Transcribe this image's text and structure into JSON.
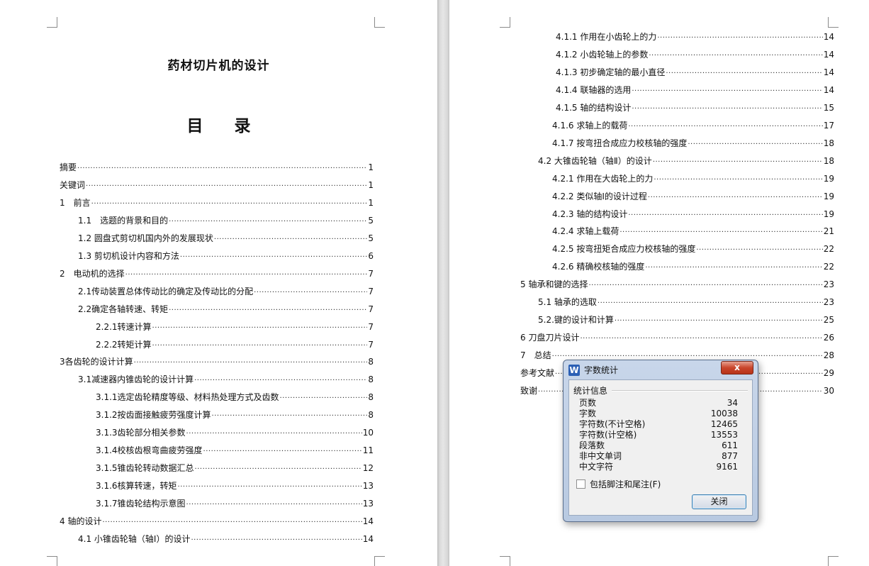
{
  "document": {
    "title": "药材切片机的设计",
    "toc_heading": "目 录"
  },
  "toc_left": [
    {
      "label": "摘要",
      "page": "1"
    },
    {
      "label": "关键词",
      "page": "1"
    },
    {
      "label": "1　前言",
      "page": "1"
    },
    {
      "label": "1.1　选题的背景和目的",
      "page": "5"
    },
    {
      "label": "1.2 圆盘式剪切机国内外的发展现状",
      "page": "5"
    },
    {
      "label": "1.3 剪切机设计内容和方法",
      "page": "6"
    },
    {
      "label": "2　电动机的选择",
      "page": "7"
    },
    {
      "label": "2.1传动装置总体传动比的确定及传动比的分配",
      "page": "7"
    },
    {
      "label": "2.2确定各轴转速、转矩",
      "page": "7"
    },
    {
      "label": "2.2.1转速计算",
      "page": "7"
    },
    {
      "label": "2.2.2转矩计算",
      "page": "7"
    },
    {
      "label": "3各齿轮的设计计算",
      "page": "8"
    },
    {
      "label": "3.1减速器内锥齿轮的设计计算",
      "page": "8"
    },
    {
      "label": "3.1.1选定齿轮精度等级、材料热处理方式及齿数",
      "page": "8"
    },
    {
      "label": "3.1.2按齿面接触疲劳强度计算",
      "page": "8"
    },
    {
      "label": "3.1.3齿轮部分相关参数",
      "page": "10"
    },
    {
      "label": "3.1.4校核齿根弯曲疲劳强度",
      "page": "11"
    },
    {
      "label": "3.1.5锥齿轮转动数据汇总",
      "page": "12"
    },
    {
      "label": "3.1.6核算转速，转矩",
      "page": "13"
    },
    {
      "label": "3.1.7锥齿轮结构示意图",
      "page": "13"
    },
    {
      "label": "4 轴的设计",
      "page": "14"
    },
    {
      "label": "4.1 小锥齿轮轴（轴Ⅰ）的设计",
      "page": "14"
    }
  ],
  "toc_right": [
    {
      "label": "4.1.1 作用在小齿轮上的力",
      "page": "14"
    },
    {
      "label": "4.1.2 小齿轮轴上的参数",
      "page": "14"
    },
    {
      "label": "4.1.3 初步确定轴的最小直径",
      "page": "14"
    },
    {
      "label": "4.1.4 联轴器的选用",
      "page": "14"
    },
    {
      "label": "4.1.5 轴的结构设计",
      "page": "15"
    },
    {
      "label": "4.1.6 求轴上的载荷",
      "page": "17"
    },
    {
      "label": "4.1.7 按弯扭合成应力校核轴的强度",
      "page": "18"
    },
    {
      "label": "4.2 大锥齿轮轴（轴Ⅱ）的设计",
      "page": "18"
    },
    {
      "label": "4.2.1 作用在大齿轮上的力",
      "page": "19"
    },
    {
      "label": "4.2.2 类似轴Ⅰ的设计过程",
      "page": "19"
    },
    {
      "label": "4.2.3 轴的结构设计",
      "page": "19"
    },
    {
      "label": "4.2.4 求轴上载荷",
      "page": "21"
    },
    {
      "label": "4.2.5 按弯扭矩合成应力校核轴的强度",
      "page": "22"
    },
    {
      "label": "4.2.6 精确校核轴的强度",
      "page": "22"
    },
    {
      "label": "5 轴承和键的选择",
      "page": "23"
    },
    {
      "label": "5.1 轴承的选取",
      "page": "23"
    },
    {
      "label": "5.2.键的设计和计算",
      "page": "25"
    },
    {
      "label": "6 刀盘刀片设计",
      "page": "26"
    },
    {
      "label": "7　总结",
      "page": "28"
    },
    {
      "label": "参考文献",
      "page": "29"
    },
    {
      "label": "致谢",
      "page": "30"
    }
  ],
  "dialog": {
    "title": "字数统计",
    "close_x": "x",
    "group_label": "统计信息",
    "stats": [
      {
        "label": "页数",
        "value": "34"
      },
      {
        "label": "字数",
        "value": "10038"
      },
      {
        "label": "字符数(不计空格)",
        "value": "12465"
      },
      {
        "label": "字符数(计空格)",
        "value": "13553"
      },
      {
        "label": "段落数",
        "value": "611"
      },
      {
        "label": "非中文单词",
        "value": "877"
      },
      {
        "label": "中文字符",
        "value": "9161"
      }
    ],
    "checkbox_label": "包括脚注和尾注(F)",
    "checkbox_checked": false,
    "button_label": "关闭"
  }
}
